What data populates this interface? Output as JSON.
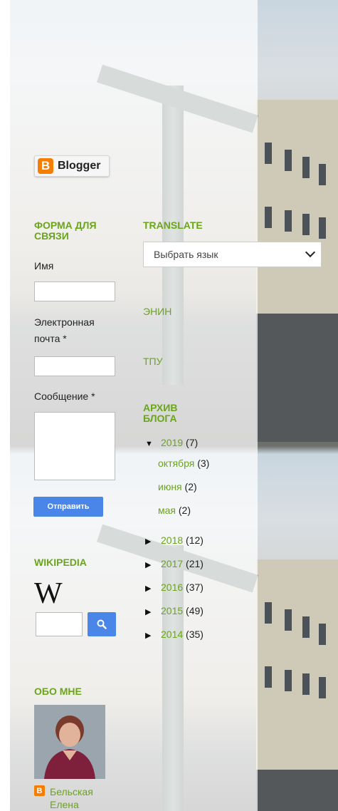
{
  "blogger_badge": {
    "label": "Blogger",
    "logo_letter": "B"
  },
  "contact_form": {
    "title": "ФОРМА ДЛЯ СВЯЗИ",
    "name_label": "Имя",
    "email_label_line1": "Электронная",
    "email_label_line2": "почта *",
    "message_label": "Сообщение *",
    "submit_label": "Отправить"
  },
  "translate": {
    "title": "TRANSLATE",
    "select_value": "Выбрать язык"
  },
  "links": {
    "enin": "ЭНИН",
    "tpu": "ТПУ"
  },
  "archive": {
    "title_line1": "АРХИВ",
    "title_line2": "БЛОГА",
    "expanded_year": {
      "year": "2019",
      "count": "(7)"
    },
    "months": [
      {
        "name": "октября",
        "count": "(3)"
      },
      {
        "name": "июня",
        "count": "(2)"
      },
      {
        "name": "мая",
        "count": "(2)"
      }
    ],
    "years": [
      {
        "year": "2018",
        "count": "(12)"
      },
      {
        "year": "2017",
        "count": "(21)"
      },
      {
        "year": "2016",
        "count": "(37)"
      },
      {
        "year": "2015",
        "count": "(49)"
      },
      {
        "year": "2014",
        "count": "(35)"
      }
    ],
    "expanded_arrow": "▼",
    "collapsed_arrow": "▶"
  },
  "wikipedia": {
    "title": "WIKIPEDIA",
    "logo_letter": "W",
    "search_icon": "search-icon"
  },
  "about": {
    "title": "ОБО МНЕ",
    "profile_name_line1": "Бельская",
    "profile_name_line2": "Елена"
  },
  "colors": {
    "link_green": "#6aa51a",
    "button_blue": "#4a86e8",
    "blogger_orange": "#f57d00"
  }
}
